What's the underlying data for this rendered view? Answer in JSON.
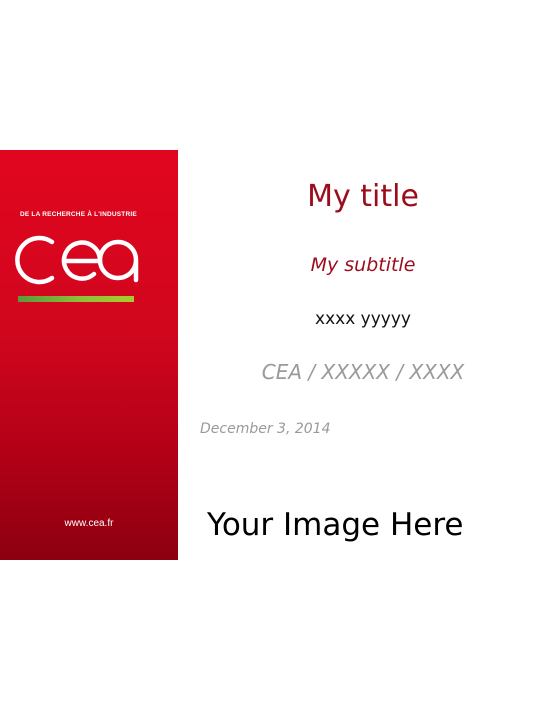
{
  "banner": {
    "tagline": "DE LA RECHERCHE À L'INDUSTRIE",
    "logo": "cea",
    "website": "www.cea.fr"
  },
  "slide": {
    "title": "My title",
    "subtitle": "My subtitle",
    "author": "xxxx yyyyy",
    "institute": "CEA / XXXXX / XXXX",
    "date": "December 3, 2014",
    "image_placeholder": "Your Image Here"
  },
  "colors": {
    "brand_red": "#e1061f",
    "title_red": "#9b0d1c",
    "muted_gray": "#9a9a9a",
    "logo_bar_green": "#8fc03a"
  }
}
